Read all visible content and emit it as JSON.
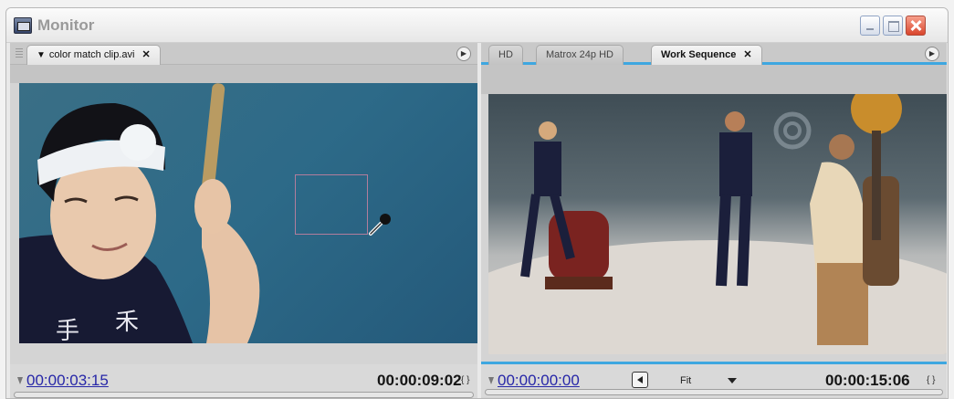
{
  "window": {
    "title": "Monitor",
    "icon": "monitor-app-icon",
    "controls": [
      "minimize-icon",
      "maximize-icon",
      "close-icon"
    ]
  },
  "source_panel": {
    "tab_label": "color match clip.avi",
    "current_timecode": "00:00:03:15",
    "duration_timecode": "00:00:09:02"
  },
  "program_panel": {
    "tabs": [
      {
        "label": "HD",
        "active": false
      },
      {
        "label": "Matrox 24p HD",
        "active": false
      },
      {
        "label": "Work Sequence",
        "active": true
      }
    ],
    "current_timecode": "00:00:00:00",
    "zoom_label": "Fit",
    "duration_timecode": "00:00:15:06"
  },
  "colors": {
    "accent": "#3ea7e0",
    "timecode_link": "#2727a8",
    "sample_box": "#b27d9c"
  }
}
